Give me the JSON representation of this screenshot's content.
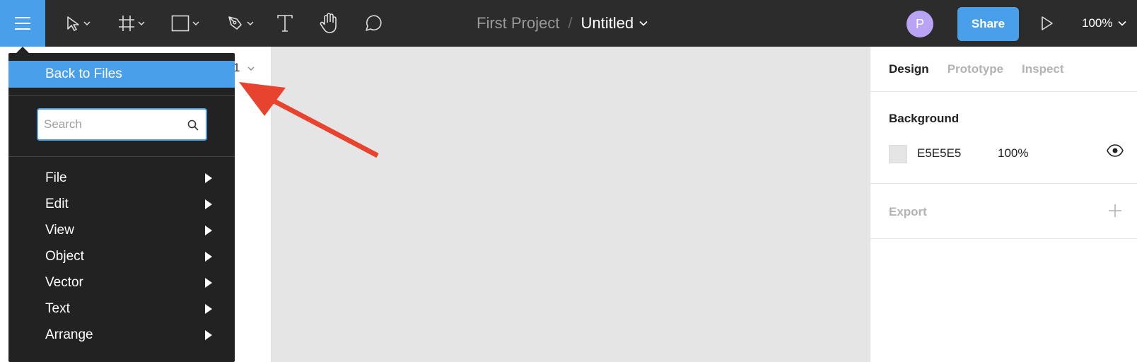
{
  "toolbar": {
    "project_name": "First Project",
    "separator": "/",
    "file_name": "Untitled",
    "avatar_initial": "P",
    "share_label": "Share",
    "zoom_level": "100%",
    "tools": [
      "menu-icon",
      "move-icon",
      "frame-icon",
      "rectangle-icon",
      "pen-icon",
      "text-icon",
      "hand-icon",
      "comment-icon"
    ]
  },
  "left_panel": {
    "page_fragment": "1"
  },
  "menu": {
    "back_label": "Back to Files",
    "search_placeholder": "Search",
    "search_value": "",
    "items": [
      {
        "label": "File"
      },
      {
        "label": "Edit"
      },
      {
        "label": "View"
      },
      {
        "label": "Object"
      },
      {
        "label": "Vector"
      },
      {
        "label": "Text"
      },
      {
        "label": "Arrange"
      }
    ]
  },
  "right_panel": {
    "tabs": [
      {
        "label": "Design",
        "active": true
      },
      {
        "label": "Prototype",
        "active": false
      },
      {
        "label": "Inspect",
        "active": false
      }
    ],
    "background": {
      "title": "Background",
      "hex": "E5E5E5",
      "opacity": "100%"
    },
    "export": {
      "title": "Export"
    }
  },
  "colors": {
    "accent": "#4a9fea",
    "toolbar_bg": "#2c2c2c",
    "menu_bg": "#222222",
    "canvas_bg": "#e5e5e5",
    "avatar_bg": "#b8a3f5",
    "annotation": "#e8432e"
  }
}
